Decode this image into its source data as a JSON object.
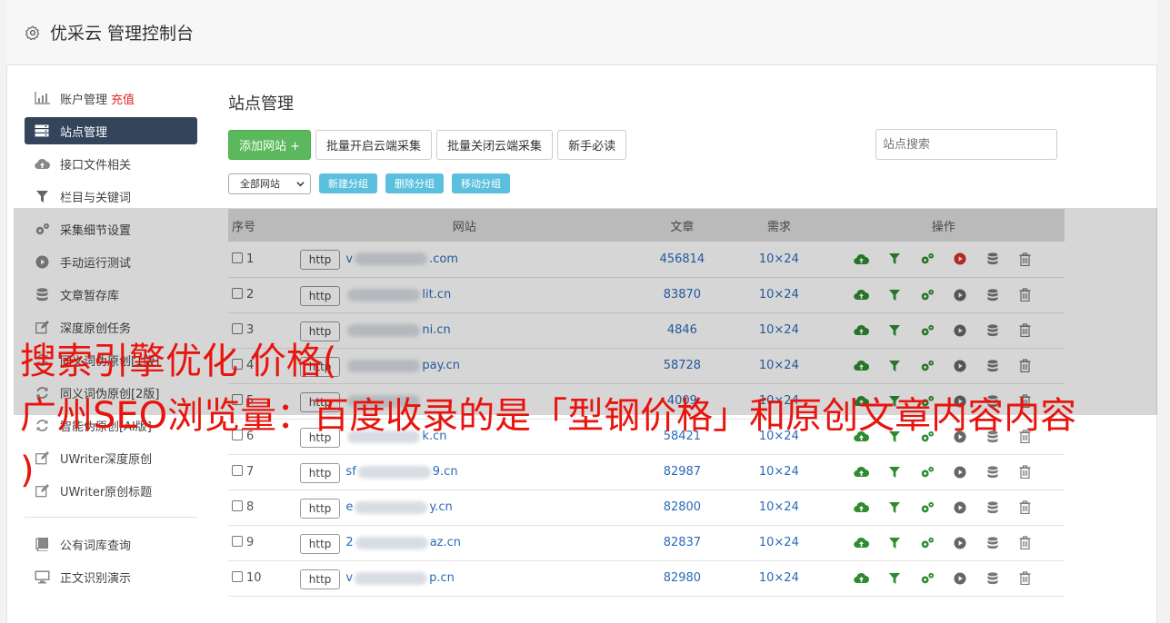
{
  "header": {
    "title": "优采云 管理控制台"
  },
  "sidebar": {
    "items": [
      {
        "label": "账户管理",
        "extra": "充值",
        "icon": "bar-chart-icon"
      },
      {
        "label": "站点管理",
        "icon": "server-icon",
        "active": true
      },
      {
        "label": "接口文件相关",
        "icon": "cloud-upload-icon"
      },
      {
        "label": "栏目与关键词",
        "icon": "filter-icon"
      },
      {
        "label": "采集细节设置",
        "icon": "gears-icon"
      },
      {
        "label": "手动运行测试",
        "icon": "play-circle-icon"
      },
      {
        "label": "文章暂存库",
        "icon": "database-icon"
      },
      {
        "label": "深度原创任务",
        "icon": "edit-icon"
      },
      {
        "label": "同义词伪原创[1版]",
        "icon": "refresh-icon"
      },
      {
        "label": "同义词伪原创[2版]",
        "icon": "refresh-icon"
      },
      {
        "label": "智能伪原创[AI版]",
        "icon": "refresh-icon"
      },
      {
        "label": "UWriter深度原创",
        "icon": "edit-icon"
      },
      {
        "label": "UWriter原创标题",
        "icon": "edit-icon"
      }
    ],
    "bottom_items": [
      {
        "label": "公有词库查询",
        "icon": "book-icon"
      },
      {
        "label": "正文识别演示",
        "icon": "monitor-icon"
      }
    ]
  },
  "main": {
    "title": "站点管理",
    "buttons": {
      "add_site": "添加网站 +",
      "batch_enable": "批量开启云端采集",
      "batch_disable": "批量关闭云端采集",
      "newbie": "新手必读"
    },
    "search_placeholder": "站点搜索",
    "group_select": "全部网站",
    "group_buttons": {
      "new": "新建分组",
      "delete": "删除分组",
      "move": "移动分组"
    },
    "table": {
      "headers": {
        "seq": "序号",
        "site": "网站",
        "articles": "文章",
        "demand": "需求",
        "ops": "操作"
      },
      "rows": [
        {
          "seq": "1",
          "prefix": "v",
          "suffix": ".com",
          "articles": "456814",
          "demand": "10×24",
          "running": true
        },
        {
          "seq": "2",
          "prefix": "",
          "suffix": "lit.cn",
          "articles": "83870",
          "demand": "10×24",
          "running": false
        },
        {
          "seq": "3",
          "prefix": "",
          "suffix": "ni.cn",
          "articles": "4846",
          "demand": "10×24",
          "running": false
        },
        {
          "seq": "4",
          "prefix": "",
          "suffix": "pay.cn",
          "articles": "58728",
          "demand": "10×24",
          "running": false
        },
        {
          "seq": "5",
          "prefix": "",
          "suffix": "",
          "articles": "4009",
          "demand": "10×24",
          "running": false
        },
        {
          "seq": "6",
          "prefix": "",
          "suffix": "k.cn",
          "articles": "58421",
          "demand": "10×24",
          "running": false
        },
        {
          "seq": "7",
          "prefix": "sf",
          "suffix": "9.cn",
          "articles": "82987",
          "demand": "10×24",
          "running": false
        },
        {
          "seq": "8",
          "prefix": "e",
          "suffix": "y.cn",
          "articles": "82800",
          "demand": "10×24",
          "running": false
        },
        {
          "seq": "9",
          "prefix": "2",
          "suffix": "az.cn",
          "articles": "82837",
          "demand": "10×24",
          "running": false
        },
        {
          "seq": "10",
          "prefix": "v",
          "suffix": "p.cn",
          "articles": "82980",
          "demand": "10×24",
          "running": false
        }
      ],
      "http_label": "http"
    }
  },
  "overlay_text": "搜索引擎优化 价格(\n广州SEO浏览量：百度收录的是「型钢价格」和原创文章内容内容\n)",
  "colors": {
    "active_bg": "#34445b",
    "link": "#2a6ab8",
    "overlay_text": "#e8140d",
    "green": "#5cb85c",
    "info": "#5bc0de"
  }
}
